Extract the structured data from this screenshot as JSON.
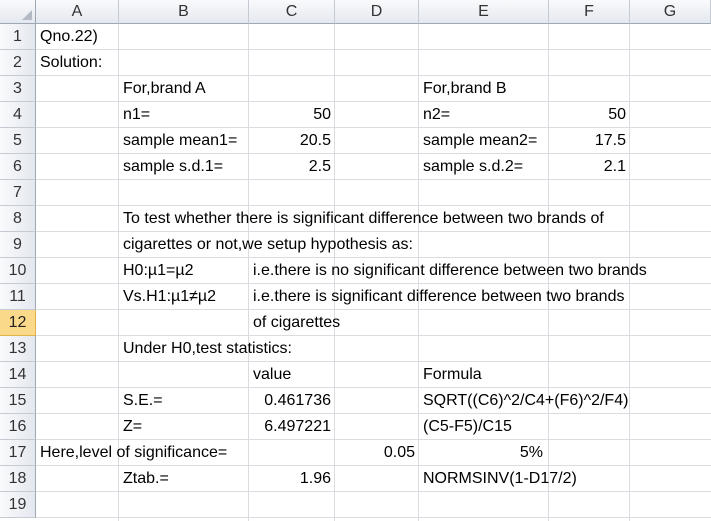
{
  "columns": [
    "A",
    "B",
    "C",
    "D",
    "E",
    "F",
    "G"
  ],
  "rows": [
    "1",
    "2",
    "3",
    "4",
    "5",
    "6",
    "7",
    "8",
    "9",
    "10",
    "11",
    "12",
    "13",
    "14",
    "15",
    "16",
    "17",
    "18",
    "19"
  ],
  "cells": {
    "a1": "Qno.22)",
    "a2": "Solution:",
    "b3": "For,brand A",
    "e3": "For,brand B",
    "b4": "n1=",
    "c4": "50",
    "e4": "n2=",
    "f4": "50",
    "b5": "sample mean1=",
    "c5": "20.5",
    "e5": "sample mean2=",
    "f5": "17.5",
    "b6": "sample s.d.1=",
    "c6": "2.5",
    "e6": "sample s.d.2=",
    "f6": "2.1",
    "b8": "To test whether there is significant difference between two brands of",
    "b9": "cigarettes or not,we setup hypothesis as:",
    "b10": "H0:µ1=µ2",
    "c10": "i.e.there is no significant difference between two brands",
    "b11": "Vs.H1:µ1≠µ2",
    "c11": "i.e.there is significant difference between two brands",
    "c12": "of cigarettes",
    "b13": "Under H0,test statistics:",
    "c14": "value",
    "e14": "Formula",
    "b15": "S.E.=",
    "c15": "0.461736",
    "e15": "SQRT((C6)^2/C4+(F6)^2/F4)",
    "b16": "Z=",
    "c16": "6.497221",
    "e16": "(C5-F5)/C15",
    "a17": "Here,level of significance=",
    "d17": "0.05",
    "e17": "5%",
    "b18": "Ztab.=",
    "c18": "1.96",
    "e18": "NORMSINV(1-D17/2)"
  }
}
